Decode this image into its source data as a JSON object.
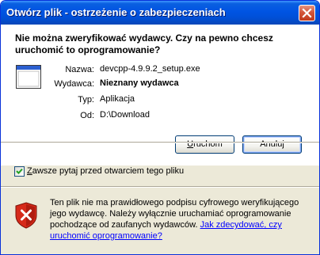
{
  "window": {
    "title": "Otwórz plik - ostrzeżenie o zabezpieczeniach"
  },
  "question": "Nie można zweryfikować wydawcy. Czy na pewno chcesz uruchomić to oprogramowanie?",
  "details": {
    "name_label": "Nazwa:",
    "name_value": "devcpp-4.9.9.2_setup.exe",
    "publisher_label": "Wydawca:",
    "publisher_value": "Nieznany wydawca",
    "type_label": "Typ:",
    "type_value": "Aplikacja",
    "from_label": "Od:",
    "from_value": "D:\\Download"
  },
  "buttons": {
    "run_mnemonic": "U",
    "run_rest": "ruchom",
    "cancel": "Anuluj"
  },
  "checkbox": {
    "checked": true,
    "label_mnemonic": "Z",
    "label_rest": "awsze pytaj przed otwarciem tego pliku"
  },
  "warning": {
    "text": "Ten plik nie ma prawidłowego podpisu cyfrowego weryfikującego jego wydawcę. Należy wyłącznie uruchamiać oprogramowanie pochodzące od zaufanych wydawców.",
    "link": "Jak zdecydować, czy uruchomić oprogramowanie?"
  },
  "icons": {
    "close": "close-icon",
    "app": "application-window-icon",
    "shield": "security-shield-icon",
    "check": "checkmark-icon"
  },
  "colors": {
    "titlebar": "#0054e3",
    "dialog_bg": "#ece9d8",
    "link": "#0000ff",
    "shield_red": "#d62a1a"
  }
}
